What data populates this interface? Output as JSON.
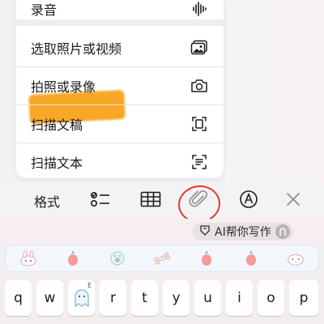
{
  "menu": {
    "items": [
      {
        "label": "录音",
        "icon": "waveform-icon"
      },
      {
        "label": "选取照片或视频",
        "icon": "photo-icon"
      },
      {
        "label": "拍照或录像",
        "icon": "camera-icon"
      },
      {
        "label": "扫描文稿",
        "icon": "scan-document-icon"
      },
      {
        "label": "扫描文本",
        "icon": "scan-text-icon"
      }
    ]
  },
  "toolbar": {
    "format_label": "格式",
    "checklist_icon": "checklist-icon",
    "table_icon": "table-icon",
    "attachment_icon": "paperclip-icon",
    "markup_icon": "pen-tip-icon",
    "close_icon": "close-icon"
  },
  "ai_writer": {
    "label": "AI帮你写作"
  },
  "emoji_row": [
    "rabbit-emoji",
    "carrot-emoji",
    "paw-emoji",
    "bone-emoji",
    "carrot-emoji",
    "carrot-emoji",
    "bunny-face-emoji"
  ],
  "keyboard": {
    "row1": [
      "q",
      "w",
      "e",
      "r",
      "t",
      "y",
      "u",
      "i",
      "o",
      "p"
    ],
    "e_superscript": "E"
  },
  "colors": {
    "highlight": "#f7a21b",
    "annotation": "#e13a2e",
    "menu_bg": "#ffffff"
  }
}
